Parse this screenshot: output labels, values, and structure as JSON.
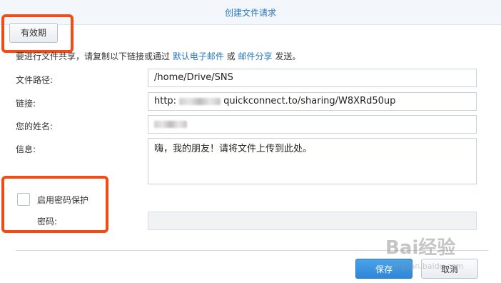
{
  "dialog": {
    "title": "创建文件请求"
  },
  "tab": {
    "validity_label": "有效期"
  },
  "intro": {
    "before": "要进行文件共享，请复制以下链接或通过 ",
    "link_email": "默认电子邮件",
    "middle": " 或 ",
    "link_share": "邮件分享",
    "after": " 发送。"
  },
  "form": {
    "path_label": "文件路径:",
    "path_value": "/home/Drive/SNS",
    "link_label": "链接:",
    "link_prefix": "http:",
    "link_suffix": "quickconnect.to/sharing/W8XRd50up",
    "name_label": "您的姓名:",
    "message_label": "信息:",
    "message_value": "嗨，我的朋友！请将文件上传到此处。",
    "password_protect_label": "启用密码保护",
    "password_label": "密码:"
  },
  "buttons": {
    "save": "保存",
    "cancel": "取消"
  },
  "watermark": {
    "brand": "Bai经验",
    "sub": "jingyan.baidu.com"
  },
  "colors": {
    "accent": "#2a78c0",
    "highlight": "#f14b16"
  }
}
